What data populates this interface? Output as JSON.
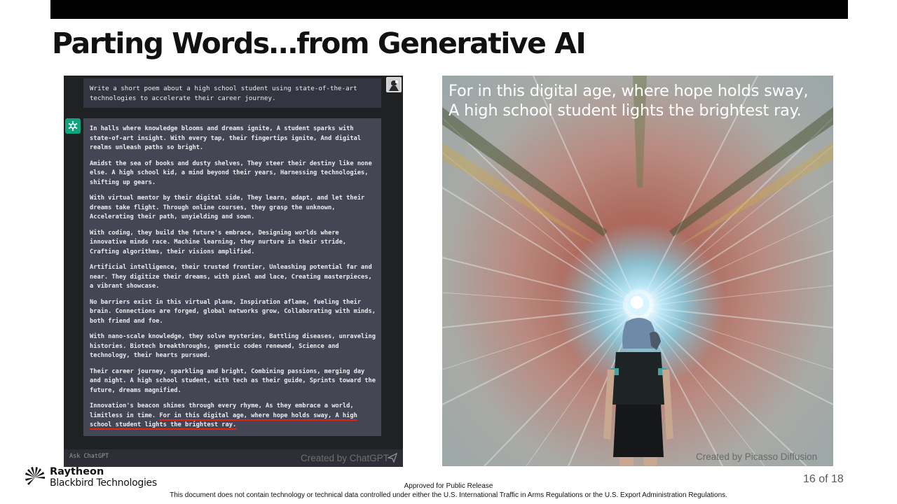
{
  "slide": {
    "title": "Parting Words…from Generative AI",
    "page_number": "16 of 18"
  },
  "chat": {
    "prompt": "Write a short poem about a high school student using state-of-the-art technologies to accelerate their career journey.",
    "stanzas": [
      "In halls where knowledge blooms and dreams ignite, A student sparks with state-of-art insight. With every tap, their fingertips ignite, And digital realms unleash paths so bright.",
      "Amidst the sea of books and dusty shelves, They steer their destiny like none else. A high school kid, a mind beyond their years, Harnessing technologies, shifting up gears.",
      "With virtual mentor by their digital side, They learn, adapt, and let their dreams take flight. Through online courses, they grasp the unknown, Accelerating their path, unyielding and sown.",
      "With coding, they build the future's embrace, Designing worlds where innovative minds race. Machine learning, they nurture in their stride, Crafting algorithms, their visions amplified.",
      "Artificial intelligence, their trusted frontier, Unleashing potential far and near. They digitize their dreams, with pixel and lace, Creating masterpieces, a vibrant showcase.",
      "No barriers exist in this virtual plane, Inspiration aflame, fueling their brain. Connections are forged, global networks grow, Collaborating with minds, both friend and foe.",
      "With nano-scale knowledge, they solve mysteries, Battling diseases, unraveling histories. Biotech breakthroughs, genetic codes renewed, Science and technology, their hearts pursued.",
      "Their career journey, sparkling and bright, Combining passions, merging day and night. A high school student, with tech as their guide, Sprints toward the future, dreams magnified."
    ],
    "last_stanza_start": "Innovation's beacon shines through every rhyme, As they embrace a world, limitless in time. ",
    "last_stanza_highlight": "For in this digital age, where hope holds sway, A high school student lights the brightest ray.",
    "input_placeholder": "Ask ChatGPT",
    "credit": "Created by ChatGPT"
  },
  "image": {
    "caption_line1": "For in this digital age, where hope holds sway,",
    "caption_line2": "A high school student lights the brightest ray.",
    "credit": "Created by Picasso Diffusion"
  },
  "footer": {
    "company_name": "Raytheon",
    "company_sub": "Blackbird Technologies",
    "approved": "Approved for Public Release",
    "disclaimer": "This document does not contain technology or technical data controlled under either the U.S. International Traffic in Arms Regulations or the U.S. Export Administration Regulations."
  },
  "colors": {
    "chat_bg": "#202123",
    "prompt_bg": "#343541",
    "answer_bg": "#444654",
    "bot_avatar": "#10a37f",
    "highlight_underline": "#e0241b"
  },
  "icons": [
    "user-avatar-icon",
    "chatgpt-logo-icon",
    "send-icon",
    "raytheon-logo-icon"
  ]
}
